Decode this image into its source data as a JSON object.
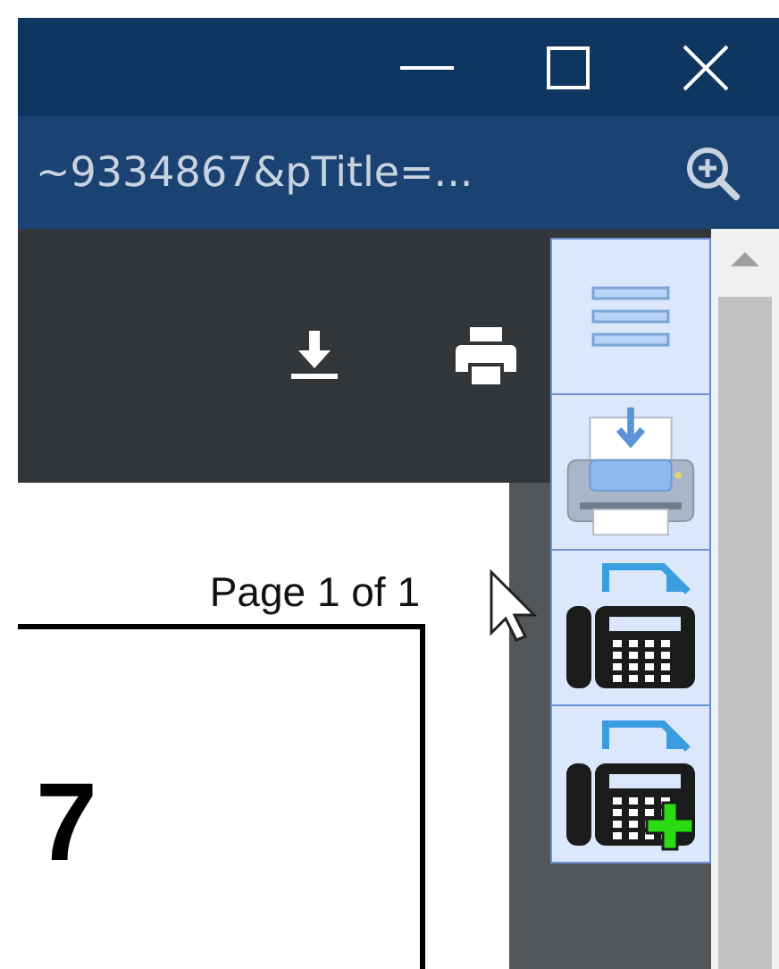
{
  "address_bar": {
    "url": "~9334867&pTitle=..."
  },
  "document": {
    "page_label": "Page 1 of 1",
    "text": "7"
  },
  "side_toolbar": {
    "buttons": [
      {
        "kind": "menu"
      },
      {
        "kind": "print"
      },
      {
        "kind": "fax"
      },
      {
        "kind": "fax-add"
      }
    ]
  }
}
